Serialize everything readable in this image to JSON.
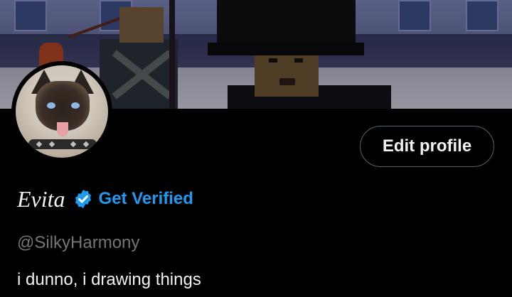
{
  "profile": {
    "display_name": "Evita",
    "handle": "@SilkyHarmony",
    "bio": "i dunno, i drawing things",
    "get_verified_label": "Get Verified",
    "edit_profile_label": "Edit profile"
  },
  "icons": {
    "verified": "verified-badge-icon"
  },
  "colors": {
    "background": "#000000",
    "accent": "#1d9bf0",
    "secondary_text": "#71767b",
    "primary_text": "#eff3f4",
    "button_border": "#536471"
  }
}
